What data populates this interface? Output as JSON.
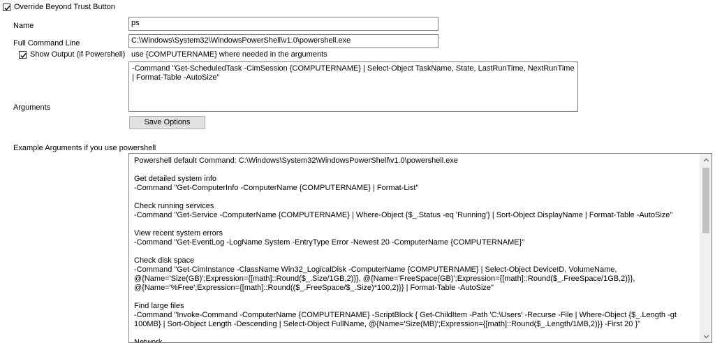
{
  "override": {
    "label": "Override Beyond Trust Button",
    "checked": true
  },
  "name": {
    "label": "Name",
    "value": "ps"
  },
  "full_command": {
    "label": "Full Command Line",
    "value": "C:\\Windows\\System32\\WindowsPowerShell\\v1.0\\powershell.exe"
  },
  "show_output": {
    "label": "Show Output (if Powershell)",
    "checked": true
  },
  "hint": "use {COMPUTERNAME}  where needed in the arguments",
  "arguments": {
    "label": "Arguments",
    "value": "-Command \"Get-ScheduledTask -CimSession {COMPUTERNAME} | Select-Object TaskName, State, LastRunTime, NextRunTime | Format-Table -AutoSize\""
  },
  "save_button": "Save Options",
  "example": {
    "label": "Example Arguments if you use powershell",
    "text": "Powershell default Command: C:\\Windows\\System32\\WindowsPowerShell\\v1.0\\powershell.exe\n\nGet detailed system info\n-Command \"Get-ComputerInfo -ComputerName {COMPUTERNAME} | Format-List\"\n\nCheck running services\n-Command \"Get-Service -ComputerName {COMPUTERNAME} | Where-Object {$_.Status -eq 'Running'} | Sort-Object DisplayName | Format-Table -AutoSize\"\n\nView recent system errors\n-Command \"Get-EventLog -LogName System -EntryType Error -Newest 20 -ComputerName {COMPUTERNAME}\"\n\nCheck disk space\n-Command \"Get-CimInstance -ClassName Win32_LogicalDisk -ComputerName {COMPUTERNAME} | Select-Object DeviceID, VolumeName, @{Name='Size(GB)';Expression={[math]::Round($_.Size/1GB,2)}}, @{Name='FreeSpace(GB)';Expression={[math]::Round($_.FreeSpace/1GB,2)}}, @{Name='%Free';Expression={[math]::Round(($_.FreeSpace/$_.Size)*100,2)}} | Format-Table -AutoSize\"\n\nFind large files\n-Command \"Invoke-Command -ComputerName {COMPUTERNAME} -ScriptBlock { Get-ChildItem -Path 'C:\\Users' -Recurse -File | Where-Object {$_.Length -gt 100MB} | Sort-Object Length -Descending | Select-Object FullName, @{Name='Size(MB)';Expression={[math]::Round($_.Length/1MB,2)}} -First 20 }\"\n\nNetwork ..."
  },
  "icons": {
    "checkbox": "checkmark-icon",
    "scroll_up": "scroll-up-arrow-icon",
    "scroll_down": "scroll-down-arrow-icon"
  }
}
